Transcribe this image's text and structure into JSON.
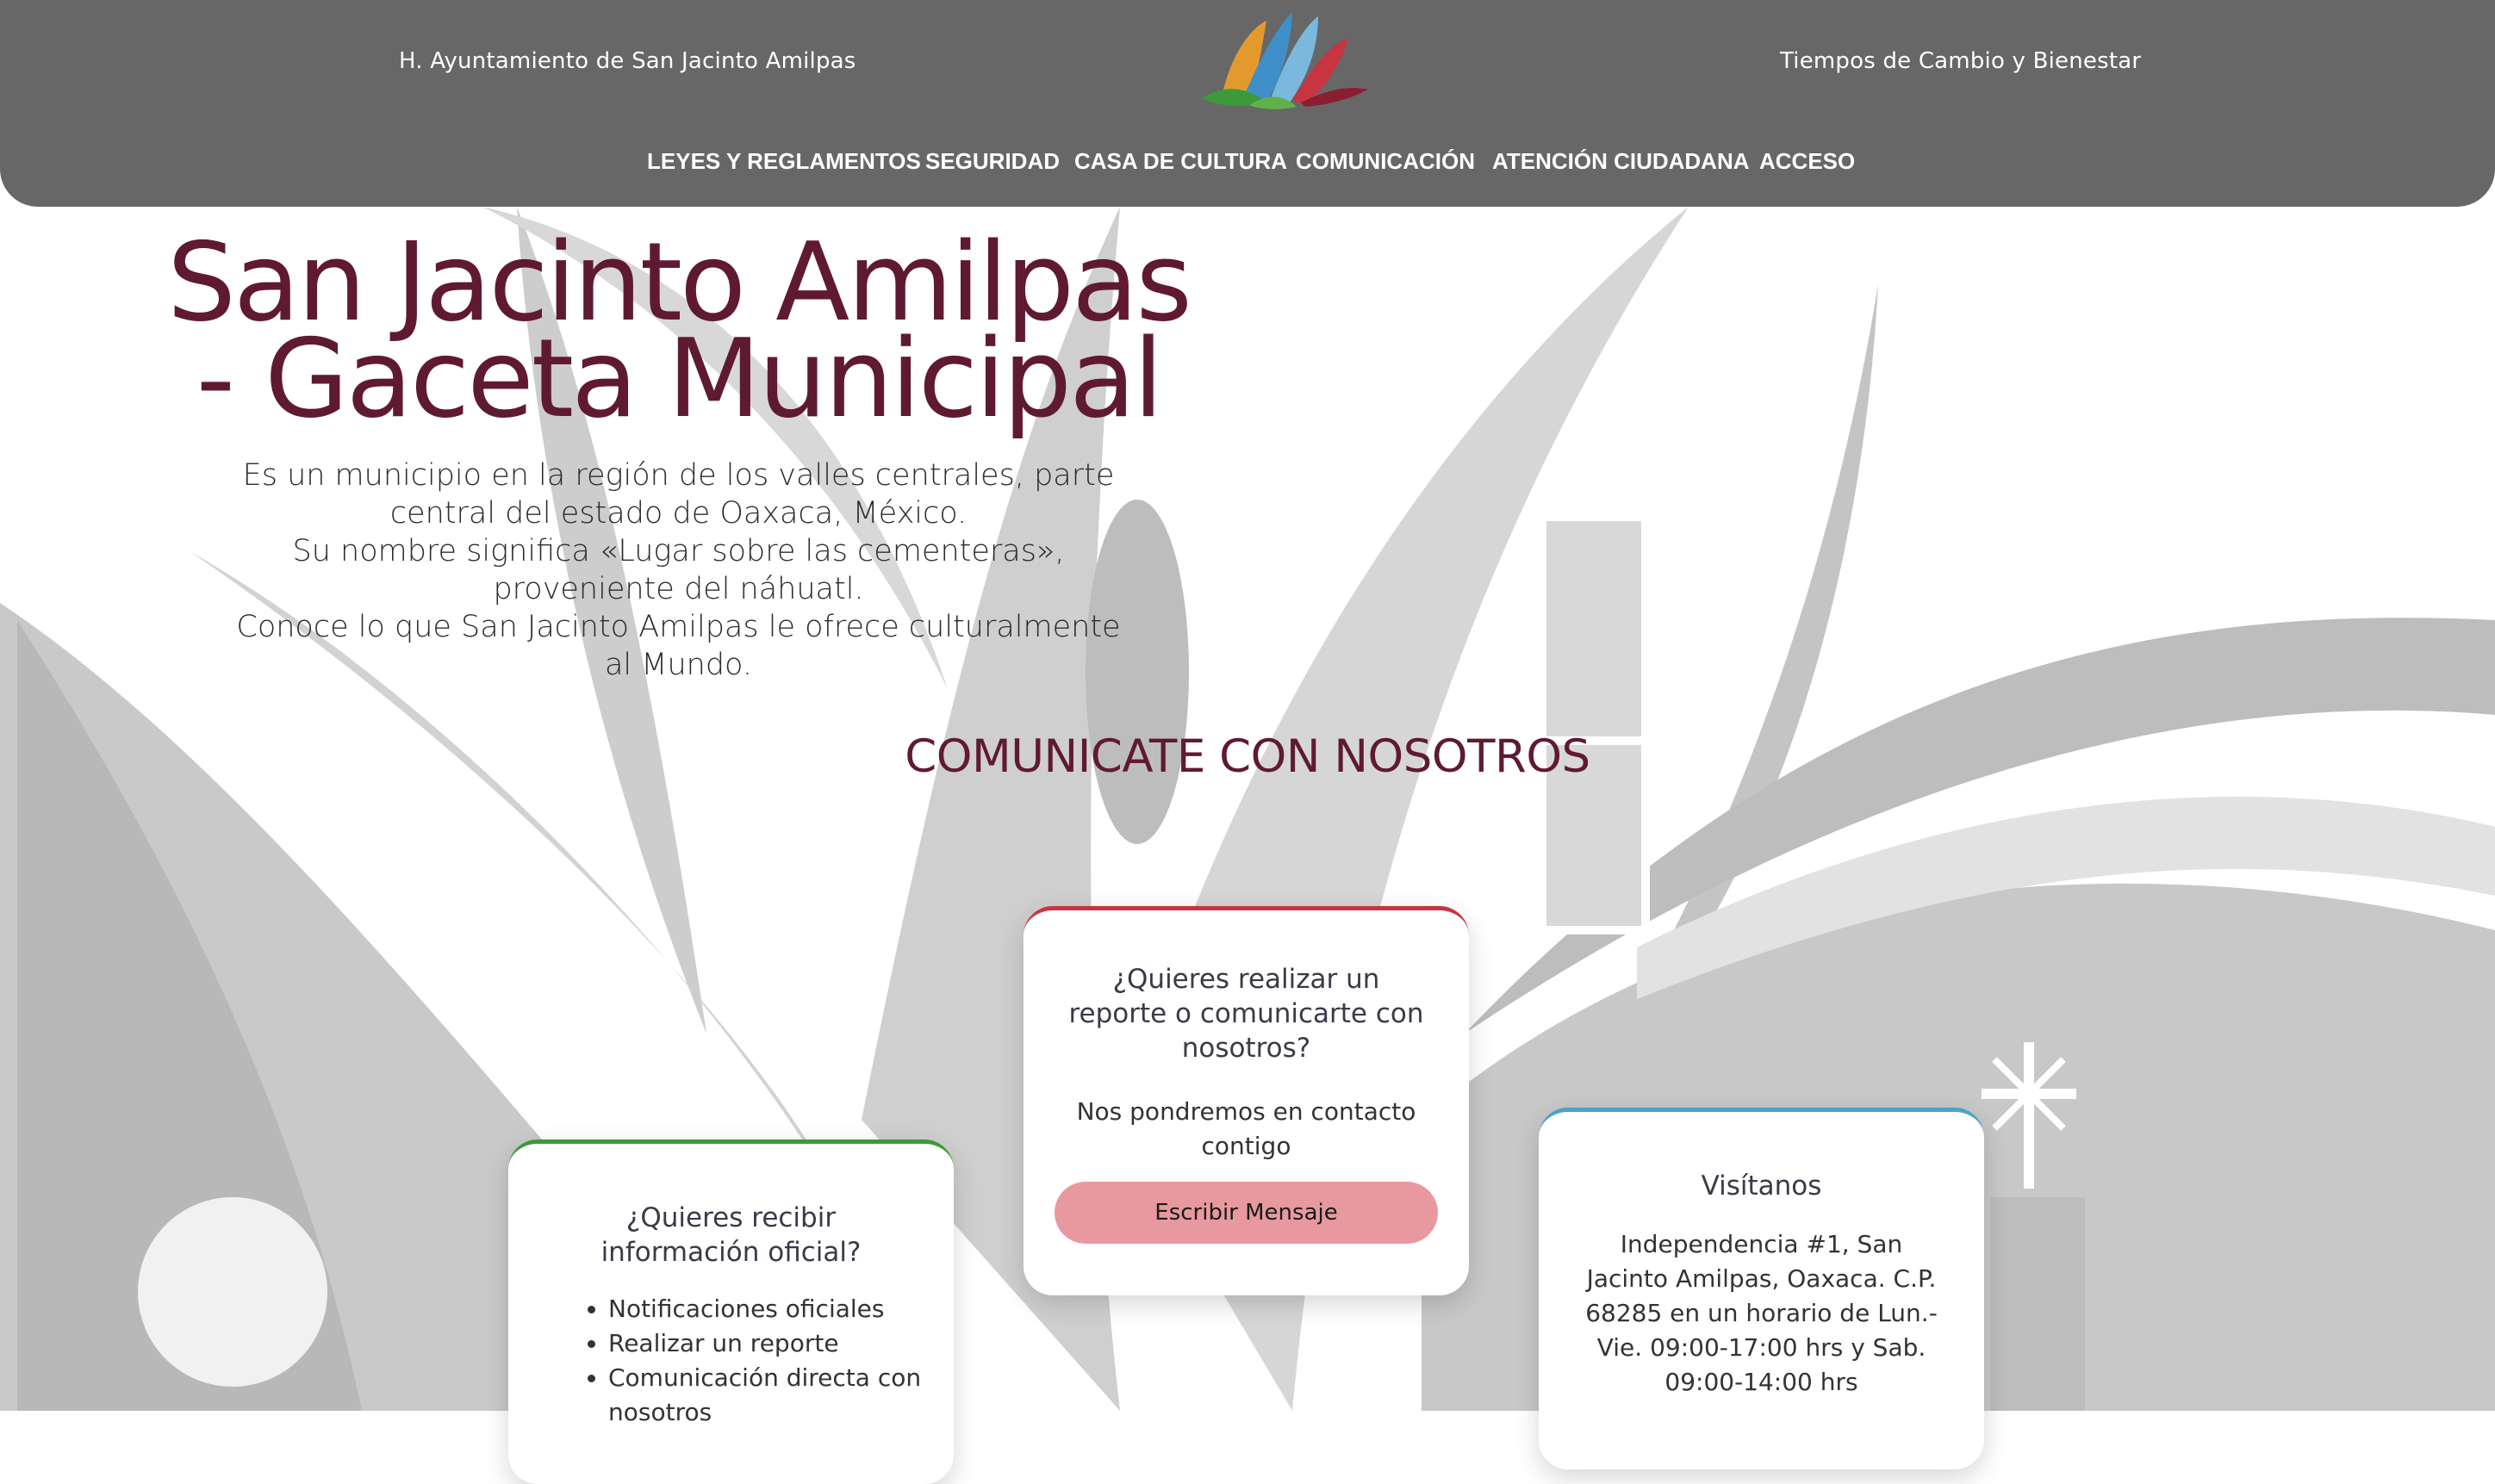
{
  "header": {
    "left_text": "H. Ayuntamiento de San Jacinto Amilpas",
    "right_text": "Tiempos de Cambio y Bienestar",
    "logo_icon": "municipal-logo-icon",
    "nav": [
      {
        "label": "LEYES Y REGLAMENTOS"
      },
      {
        "label": "SEGURIDAD"
      },
      {
        "label": "CASA DE CULTURA"
      },
      {
        "label": "COMUNICACIÓN"
      },
      {
        "label": "ATENCIÓN CIUDADANA"
      },
      {
        "label": "ACCESO"
      }
    ]
  },
  "hero": {
    "title_line1": "San Jacinto Amilpas",
    "title_line2": "- Gaceta Municipal",
    "text_lines": [
      "Es un municipio en la región de los valles centrales, parte",
      "central del estado de Oaxaca, México.",
      "Su nombre significa «Lugar sobre las cementeras»,",
      "proveniente del náhuatl.",
      "Conoce lo que San Jacinto Amilpas le ofrece culturalmente",
      "al Mundo."
    ]
  },
  "contact": {
    "section_title": "COMUNICATE CON NOSOTROS",
    "card_info": {
      "title": "¿Quieres recibir información oficial?",
      "items": [
        "Notificaciones oficiales",
        "Realizar un reporte",
        "Comunicación directa con nosotros"
      ]
    },
    "card_report": {
      "title": "¿Quieres realizar un reporte o comunicarte con nosotros?",
      "body": "Nos pondremos en contacto contigo",
      "button_label": "Escribir Mensaje"
    },
    "card_visit": {
      "title": "Visítanos",
      "body": "Independencia #1, San Jacinto Amilpas, Oaxaca. C.P. 68285 en un horario de Lun.- Vie. 09:00-17:00 hrs y Sab. 09:00-14:00 hrs"
    }
  },
  "colors": {
    "header_bg": "#676767",
    "title": "#5f1a32",
    "card_green": "#3d9a3a",
    "card_red": "#c8343f",
    "card_blue": "#4aa3c8",
    "button": "#e8999f"
  }
}
